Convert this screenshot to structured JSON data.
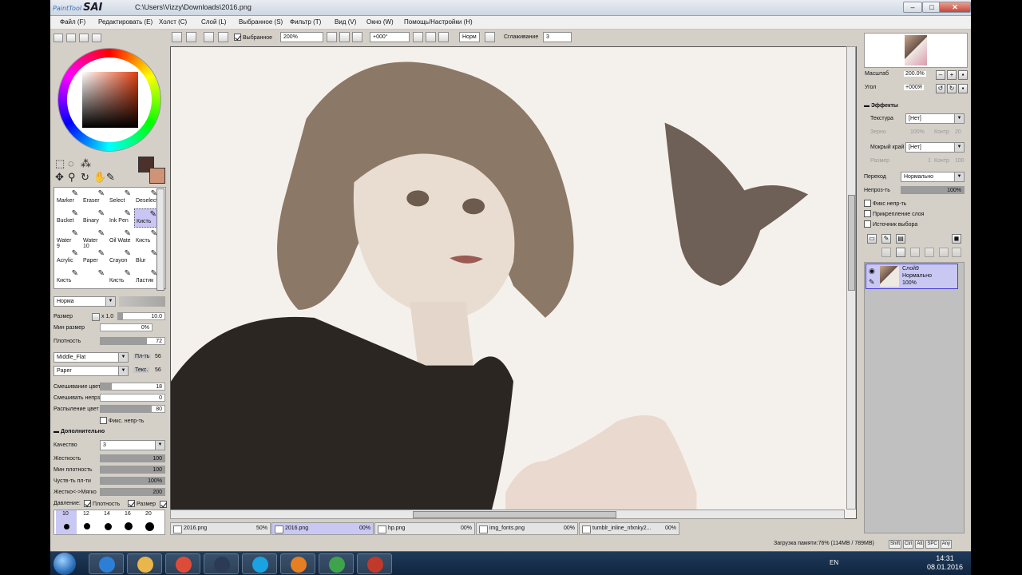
{
  "app": {
    "title_path": "C:\\Users\\Vizzy\\Downloads\\2016.png"
  },
  "window_buttons": {
    "minimize": "–",
    "maximize": "□",
    "close": "✕"
  },
  "menu": [
    "Файл (F)",
    "Редактировать (E)",
    "Холст (C)",
    "Слой (L)",
    "Выбранное (S)",
    "Фильтр (T)",
    "Вид (V)",
    "Окно (W)",
    "Помощь/Настройки (H)"
  ],
  "toolbar": {
    "selection_label": "Выбранное",
    "zoom_value": "200%",
    "angle_value": "+000°",
    "mode_value": "Норм",
    "smoothing_label": "Сглаживание",
    "smoothing_value": "3"
  },
  "colors": {
    "primary": "#4b3129",
    "secondary": "#cf9477",
    "selection": "#c9c8f3"
  },
  "brushes": [
    {
      "label": "Marker"
    },
    {
      "label": "Eraser"
    },
    {
      "label": "Select"
    },
    {
      "label": "Deselect"
    },
    {
      "label": "Bucket"
    },
    {
      "label": "Binary"
    },
    {
      "label": "Ink Pen"
    },
    {
      "label": "Кисть"
    },
    {
      "label": "Water\n9"
    },
    {
      "label": "Water\n10"
    },
    {
      "label": "Oil Wate"
    },
    {
      "label": "Кисть"
    },
    {
      "label": "Acrylic"
    },
    {
      "label": "Paper"
    },
    {
      "label": "Crayon"
    },
    {
      "label": "Blur"
    },
    {
      "label": "Кисть"
    },
    {
      "label": ""
    },
    {
      "label": "Кисть"
    },
    {
      "label": "Ластик"
    }
  ],
  "brush_settings": {
    "mode": "Норма",
    "size_label": "Размер",
    "size_mult": "x 1.0",
    "size_value": "10.0",
    "min_size_label": "Мин размер",
    "min_size_value": "0%",
    "density_label": "Плотность",
    "density_value": "72",
    "shape": "Middle_Flat",
    "shape_amount_label": "Пл-ть",
    "shape_amount": "56",
    "texture": "Paper",
    "texture_amount_label": "Текс.",
    "texture_amount": "56",
    "blend_label": "Смешивание цвет",
    "blend_value": "18",
    "dilution_label": "Смешивать непрз",
    "dilution_value": "0",
    "persistence_label": "Распыление цвет",
    "persistence_value": "80",
    "keep_opacity_label": "Фикс. непр-ть",
    "advanced_label": "Дополнительно",
    "quality_label": "Качество",
    "quality_value": "3",
    "hardness_label": "Жесткость",
    "hardness_value": "100",
    "min_density_label": "Мин плотность",
    "min_density_value": "100",
    "sensitivity_label": "Чуств-ть пл-ти",
    "sensitivity_value": "100%",
    "softness_label": "Жестко<->Мягко",
    "softness_value": "200",
    "pressure_label": "Давление:",
    "pressure_density": "Плотность",
    "pressure_size": "Размер",
    "dot_sizes": [
      "10",
      "12",
      "14",
      "16",
      "20"
    ]
  },
  "progress": {
    "size": 0.1,
    "density": 0.72,
    "blend": 0.18,
    "dilution": 0,
    "persistence": 0.8,
    "hardness": 1,
    "min_density": 1,
    "sensitivity": 1,
    "softness": 1
  },
  "tabs": [
    {
      "name": "2016.png",
      "pct": "50%"
    },
    {
      "name": "2016.png",
      "pct": "00%",
      "active": true
    },
    {
      "name": "hp.png",
      "pct": "00%"
    },
    {
      "name": "img_fonts.png",
      "pct": "00%"
    },
    {
      "name": "tumblr_inline_nfxnky2...",
      "pct": "00%"
    }
  ],
  "right": {
    "scale_label": "Масштаб",
    "scale_value": "200.0%",
    "angle_label": "Угол",
    "angle_value": "+000Я",
    "effects_label": "Эффекты",
    "texture_label": "Текстура",
    "texture_value": "[Нет]",
    "grain_label": "Зерно",
    "grain_value": "100%",
    "contrast_label": "Контр",
    "contrast_value": "20",
    "wet_label": "Мокрый край",
    "wet_value": "[Нет]",
    "wet_size_label": "Размер",
    "wet_size_value": "1",
    "wet_contrast_label": "Контр",
    "wet_contrast_value": "100",
    "blend_label": "Переход",
    "blend_value": "Нормально",
    "opacity_label": "Непроз-ть",
    "opacity_value": "100%",
    "lock_opacity": "Фикс непр-ть",
    "clipping": "Прикрепление слоя",
    "selection_source": "Источник выбора",
    "layer_name": "Слой9",
    "layer_mode": "Нормально",
    "layer_opacity": "100%"
  },
  "status": {
    "memory": "Загрузка памяти:76% (114MB / 789MB)",
    "keys": [
      "Shift",
      "Ctrl",
      "Alt",
      "SPC",
      "Any"
    ]
  },
  "taskbar": {
    "lang": "EN",
    "time": "14:31",
    "date": "08.01.2016",
    "apps": [
      "ie-icon",
      "folder-icon",
      "chrome-icon",
      "steam-icon",
      "skype-icon",
      "media-icon",
      "game-icon",
      "sai-icon"
    ]
  }
}
